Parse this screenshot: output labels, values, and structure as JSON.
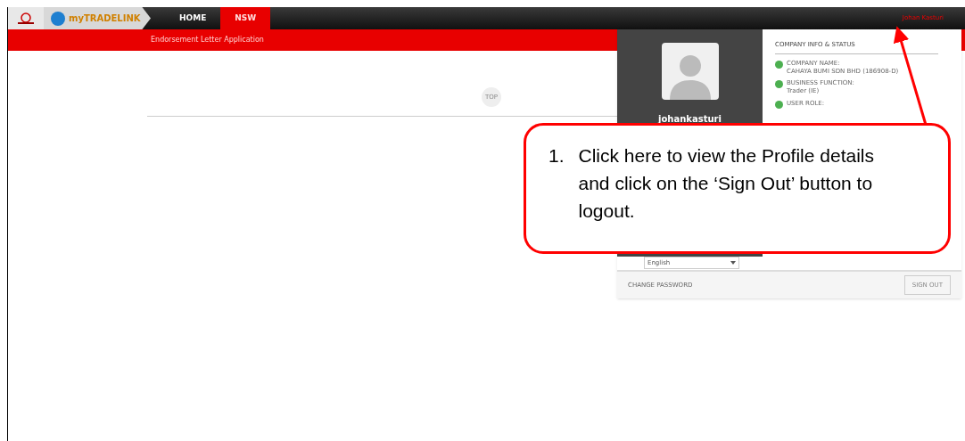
{
  "header": {
    "logo_text": "myTRADELINK",
    "nav": [
      {
        "label": "HOME",
        "selected": false
      },
      {
        "label": "NSW",
        "selected": true
      }
    ],
    "user_menu": "Johan Kasturi"
  },
  "subbar": {
    "title": "Endorsement Letter Application"
  },
  "top_button": "TOP",
  "profile_panel": {
    "username": "johankasturi",
    "section_title": "COMPANY INFO & STATUS",
    "items": [
      {
        "label": "COMPANY NAME:",
        "value": "CAHAYA BUMI SDN BHD (186908-D)"
      },
      {
        "label": "BUSINESS FUNCTION:",
        "value": "Trader (IE)"
      },
      {
        "label": "USER ROLE:"
      }
    ],
    "language": "English",
    "change_password": "CHANGE PASSWORD",
    "sign_out": "SIGN OUT"
  },
  "callout": {
    "number": "1.",
    "text": "Click here to view the Profile details and click on the ‘Sign Out’ button to logout."
  }
}
